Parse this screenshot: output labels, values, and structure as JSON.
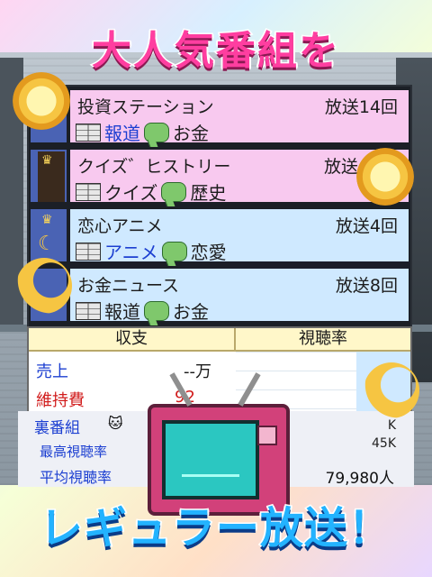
{
  "title": "大人気番組を",
  "programs": [
    {
      "name": "投資ステーション",
      "count": "放送14回",
      "genre": "報道",
      "topic": "お金",
      "genre_color": "blue"
    },
    {
      "name": "クイズ゛ヒストリー",
      "count": "放送",
      "genre": "クイズ",
      "topic": "歴史",
      "genre_color": "black"
    },
    {
      "name": "恋心アニメ",
      "count": "放送4回",
      "genre": "アニメ",
      "topic": "恋愛",
      "genre_color": "blue"
    },
    {
      "name": "お金ニュース",
      "count": "放送8回",
      "genre": "報道",
      "topic": "お金",
      "genre_color": "black"
    }
  ],
  "stats": {
    "header_income": "収支",
    "header_rating": "視聴率",
    "sales_label": "売上",
    "sales_value": "--万",
    "upkeep_label": "維持費",
    "upkeep_value": "92",
    "backshow_label": "裏番組"
  },
  "lower": {
    "max_rating_label": "最高視聴率",
    "avg_rating_label": "平均視聴率",
    "avg_value": "79,980人",
    "small_k1": "K",
    "small_k2": "45K"
  },
  "bottom_text": "レギュラー放送！"
}
